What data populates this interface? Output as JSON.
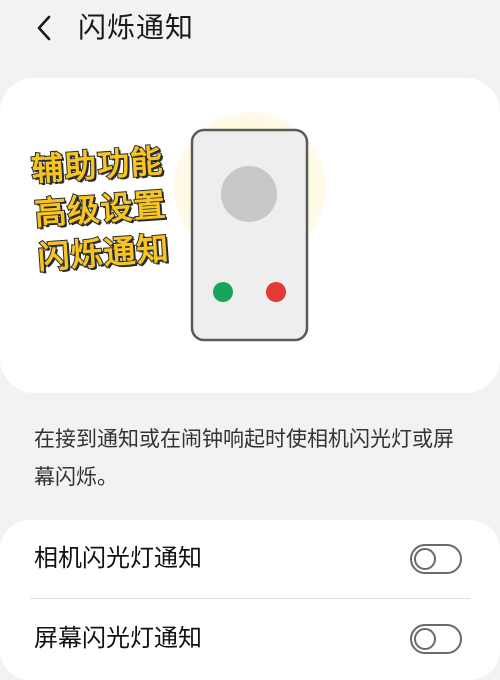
{
  "header": {
    "title": "闪烁通知",
    "back_icon": "chevron-left-icon"
  },
  "illustration": {
    "overlay_lines": [
      "辅助功能",
      "高级设置",
      "闪烁通知"
    ],
    "glow_color": "#fdf6c9",
    "overlay_color": "#f7c521",
    "indicator_colors": {
      "green": "#1aa35a",
      "red": "#e53935"
    }
  },
  "description": "在接到通知或在闹钟响起时使相机闪光灯或屏幕闪烁。",
  "settings": [
    {
      "label": "相机闪光灯通知",
      "enabled": false
    },
    {
      "label": "屏幕闪光灯通知",
      "enabled": false
    }
  ]
}
